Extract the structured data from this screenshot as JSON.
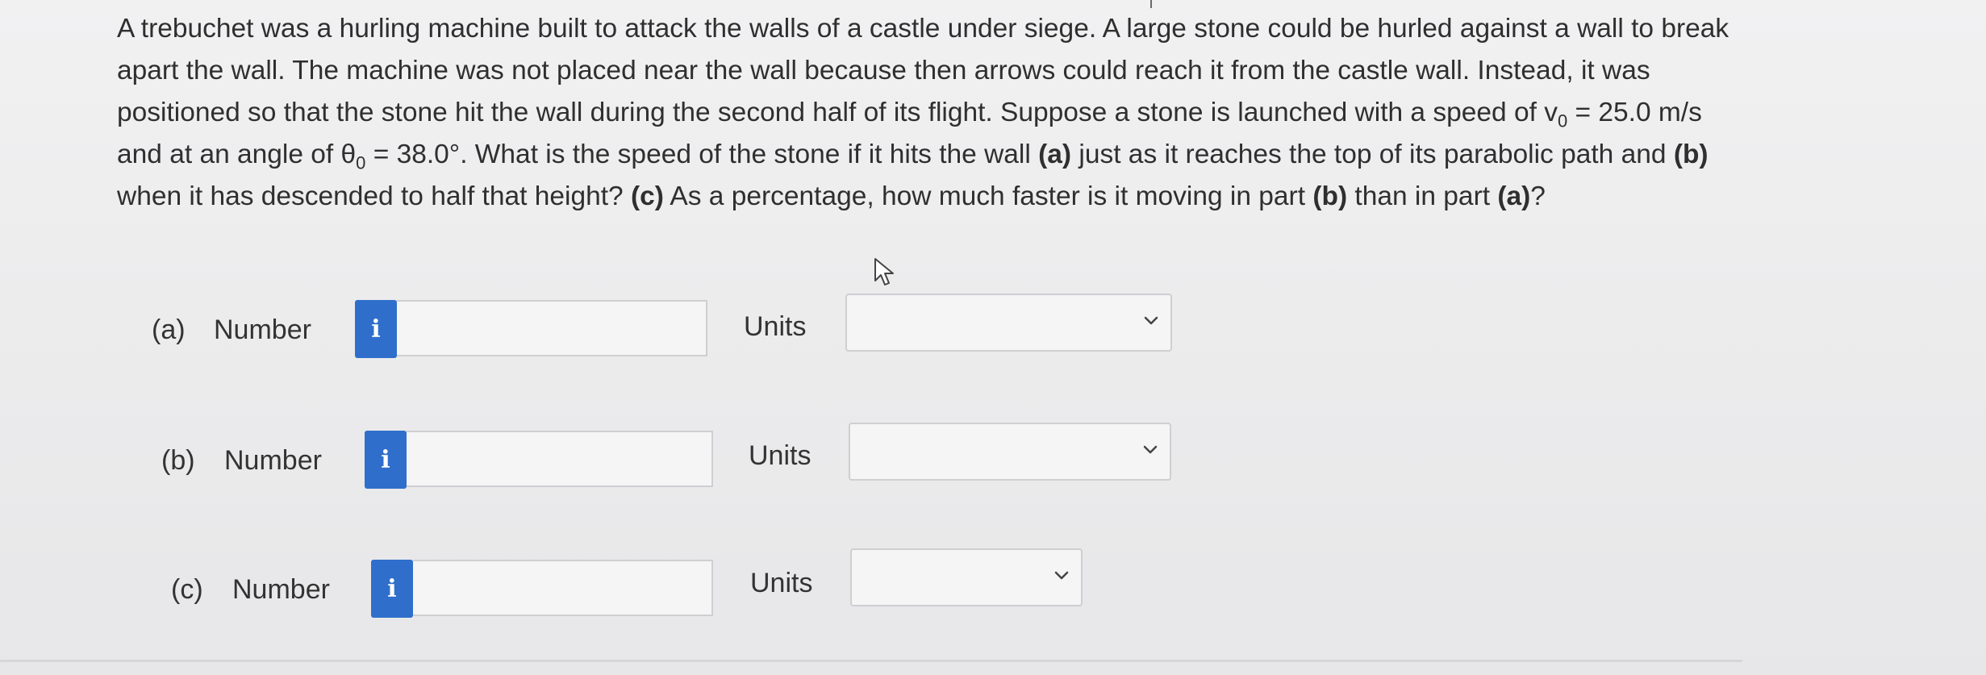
{
  "problem": {
    "line1": "A trebuchet was a hurling machine built to attack the walls of a castle under siege. A large stone could be hurled against a wall to break",
    "line2": "apart the wall. The machine was not placed near the wall because then arrows could reach it from the castle wall. Instead, it was",
    "line3": "positioned so that the stone hit the wall during the second half of its flight. Suppose a stone is launched with a speed of v",
    "line3_sub": "0",
    "line3_end": " = 25.0 m/s",
    "line4_start": "and at an angle of θ",
    "line4_sub": "0",
    "line4_mid": " = 38.0°. What is the speed of the stone if it hits the wall ",
    "line4_a": "(a)",
    "line4_mid2": " just as it reaches the top of its parabolic path and ",
    "line4_b": "(b)",
    "line5_start": "when it has descended to half that height? ",
    "line5_c": "(c)",
    "line5_mid": " As a percentage, how much faster is it moving in part ",
    "line5_b": "(b)",
    "line5_mid2": " than in part ",
    "line5_a": "(a)",
    "line5_end": "?"
  },
  "answers": [
    {
      "part": "(a)",
      "number_label": "Number",
      "info_icon": "i",
      "value": "",
      "units_label": "Units",
      "units_value": ""
    },
    {
      "part": "(b)",
      "number_label": "Number",
      "info_icon": "i",
      "value": "",
      "units_label": "Units",
      "units_value": ""
    },
    {
      "part": "(c)",
      "number_label": "Number",
      "info_icon": "i",
      "value": "",
      "units_label": "Units",
      "units_value": ""
    }
  ],
  "colors": {
    "info_button": "#2f6fcb",
    "background": "#ececed",
    "text": "#2f2f2f"
  }
}
